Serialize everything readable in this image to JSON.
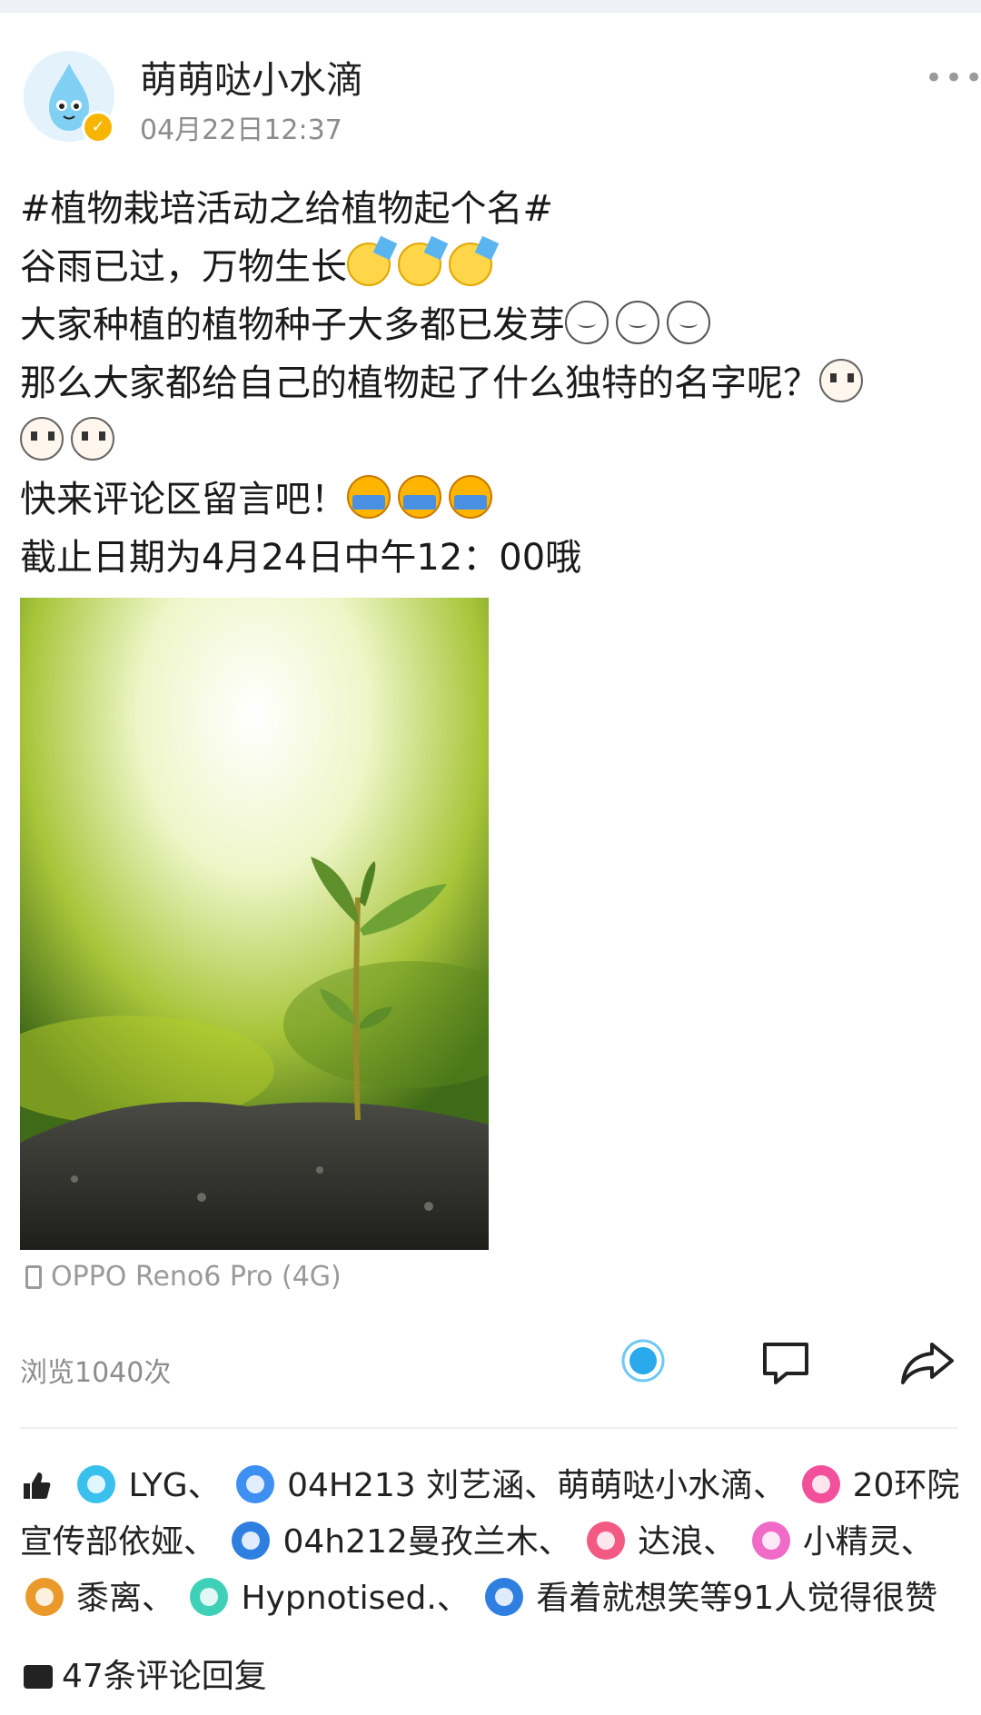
{
  "post": {
    "author": "萌萌哒小水滴",
    "time": "04月22日12:37",
    "verified": true,
    "lines": [
      "#植物栽培活动之给植物起个名#",
      "谷雨已过，万物生长",
      "大家种植的植物种子大多都已发芽",
      "那么大家都给自己的植物起了什么独特的名字呢？",
      "",
      "快来评论区留言吧！",
      "截止日期为4月24日中午12：00哦"
    ],
    "emoji_icons": [
      "party-face-icon",
      "sweat-face-icon",
      "thinking-face-icon",
      "crying-laughing-icon"
    ],
    "device": "OPPO Reno6 Pro (4G)",
    "views": "浏览1040次"
  },
  "likes": {
    "row1": [
      "LYG、",
      "04H213 刘艺涵、萌萌哒小水滴、",
      "20环院"
    ],
    "row2": [
      "宣传部依娅、",
      "04h212曼孜兰木、",
      "达浪、",
      "小精灵、"
    ],
    "row3": [
      "黍离、",
      "Hypnotised.、",
      "看着就想笑等91人觉得很赞"
    ]
  },
  "comments": {
    "label": "47条评论回复"
  },
  "colors": {
    "accent": "#4fb8f0",
    "muted": "#8c8c8c",
    "verify": "#f7b500"
  }
}
